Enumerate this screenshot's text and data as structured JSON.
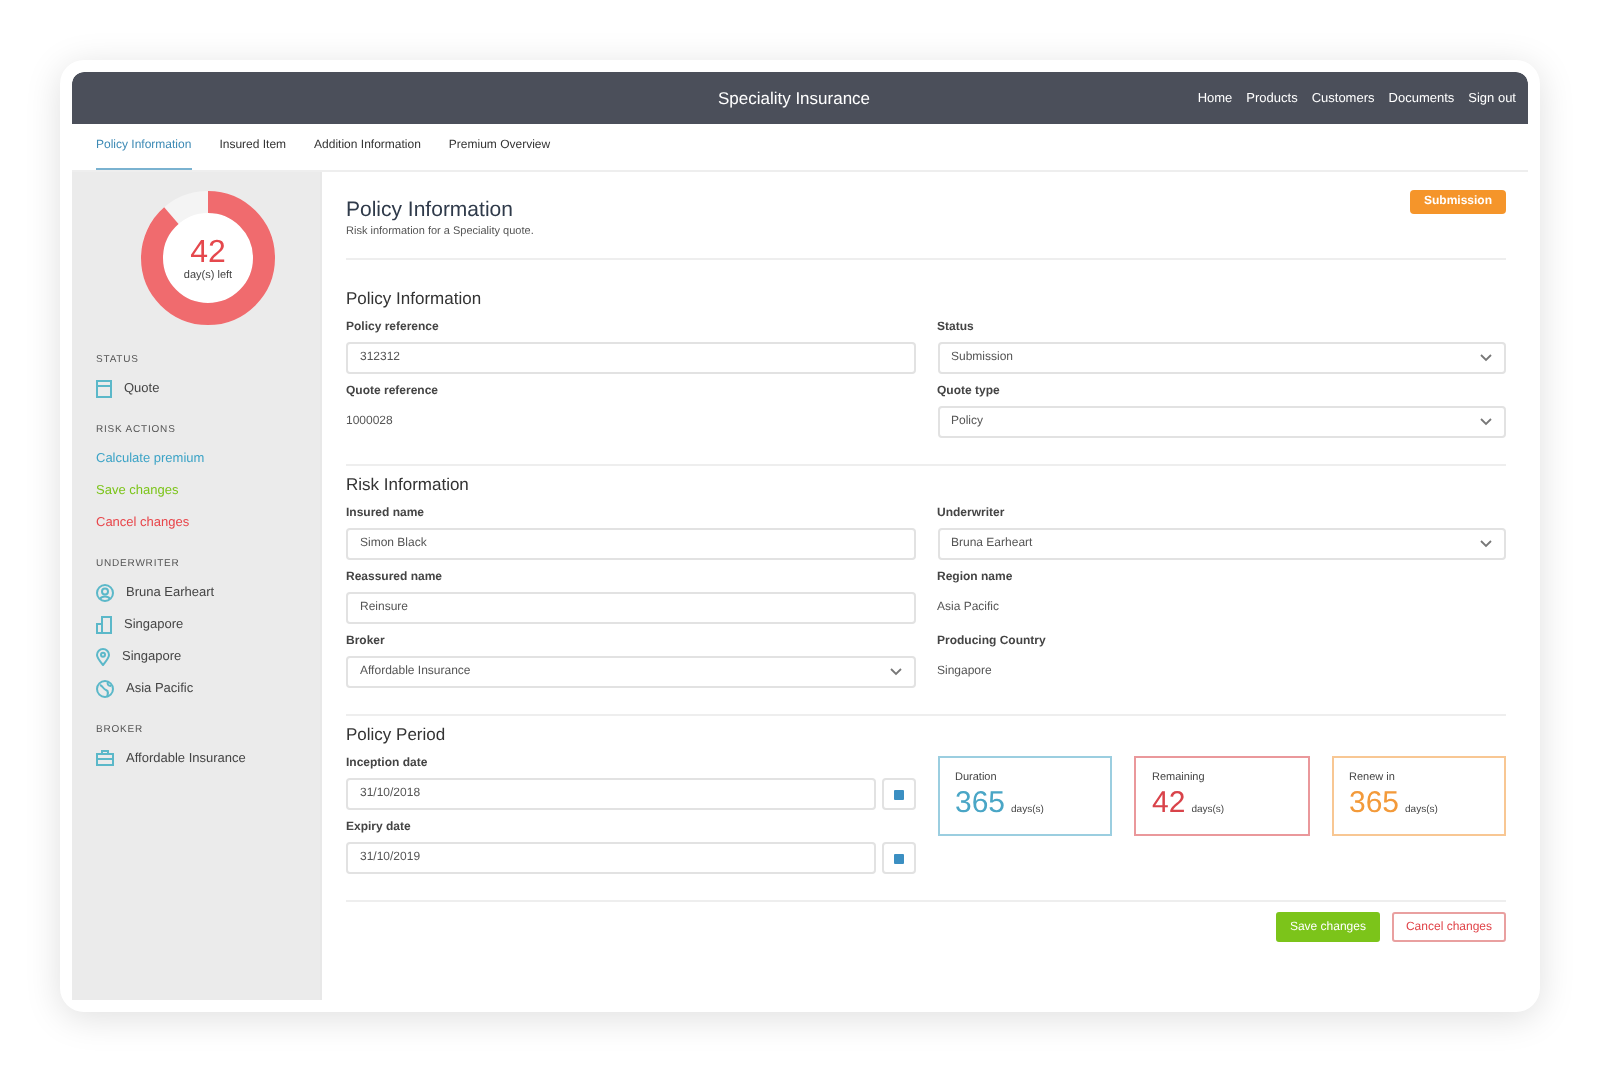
{
  "window": {
    "title": "Speciality Insurance"
  },
  "nav": [
    "Home",
    "Products",
    "Customers",
    "Documents",
    "Sign out"
  ],
  "tabs": [
    {
      "label": "Policy Information",
      "selected": true
    },
    {
      "label": "Insured Item",
      "selected": false
    },
    {
      "label": "Addition Information",
      "selected": false
    },
    {
      "label": "Premium Overview",
      "selected": false
    }
  ],
  "sidebar": {
    "countdown": {
      "value": "42",
      "caption": "day(s) left",
      "level": 0.885
    },
    "sections": [
      {
        "heading": "STATUS",
        "items": [
          {
            "label": "Quote",
            "kind": "document"
          }
        ]
      },
      {
        "heading": "RISK ACTIONS",
        "items": [
          {
            "label": "Calculate premium",
            "kind": "link",
            "color": "#3ba3c6"
          },
          {
            "label": "Save changes",
            "kind": "link",
            "color": "#7cc41a"
          },
          {
            "label": "Cancel changes",
            "kind": "link",
            "color": "#e8454a"
          }
        ]
      },
      {
        "heading": "UNDERWRITER",
        "items": [
          {
            "label": "Bruna Earheart",
            "kind": "user"
          },
          {
            "label": "Singapore",
            "kind": "building"
          },
          {
            "label": "Singapore",
            "kind": "pin"
          },
          {
            "label": "Asia Pacific",
            "kind": "globe"
          }
        ]
      },
      {
        "heading": "BROKER",
        "items": [
          {
            "label": "Affordable Insurance",
            "kind": "briefcase"
          }
        ]
      }
    ]
  },
  "page": {
    "title": "Policy Information",
    "subtitle": "Risk information for a Speciality quote.",
    "status_button": "Submission"
  },
  "sections": [
    {
      "title": "Policy Information",
      "left": [
        {
          "label": "Policy reference",
          "kind": "input",
          "value": "312312"
        },
        {
          "label": "Quote reference",
          "kind": "text",
          "value": "1000028"
        }
      ],
      "right": [
        {
          "label": "Status",
          "kind": "select",
          "value": "Submission"
        },
        {
          "label": "Quote type",
          "kind": "select",
          "value": "Policy"
        }
      ]
    },
    {
      "title": "Risk Information",
      "left": [
        {
          "label": "Insured name",
          "kind": "input",
          "value": "Simon Black"
        },
        {
          "label": "Reassured name",
          "kind": "input",
          "value": "Reinsure"
        },
        {
          "label": "Broker",
          "kind": "select",
          "value": "Affordable Insurance"
        }
      ],
      "right": [
        {
          "label": "Underwriter",
          "kind": "select",
          "value": "Bruna Earheart"
        },
        {
          "label": "Region name",
          "kind": "text",
          "value": "Asia Pacific"
        },
        {
          "label": "Producing Country",
          "kind": "text",
          "value": "Singapore"
        }
      ]
    },
    {
      "title": "Policy Period",
      "left": [
        {
          "label": "Inception date",
          "kind": "date",
          "value": "31/10/2018"
        },
        {
          "label": "Expiry date",
          "kind": "date",
          "value": "31/10/2019"
        }
      ],
      "stats": [
        {
          "label": "Duration",
          "value": "365",
          "unit": "days(s)",
          "color": "#4aa6c6"
        },
        {
          "label": "Remaining",
          "value": "42",
          "unit": "days(s)",
          "color": "#d9434a"
        },
        {
          "label": "Renew in",
          "value": "365",
          "unit": "days(s)",
          "color": "#f39a3a"
        }
      ]
    }
  ],
  "buttons": [
    {
      "label": "Save changes",
      "kind": "primary"
    },
    {
      "label": "Cancel changes",
      "kind": "danger"
    }
  ]
}
